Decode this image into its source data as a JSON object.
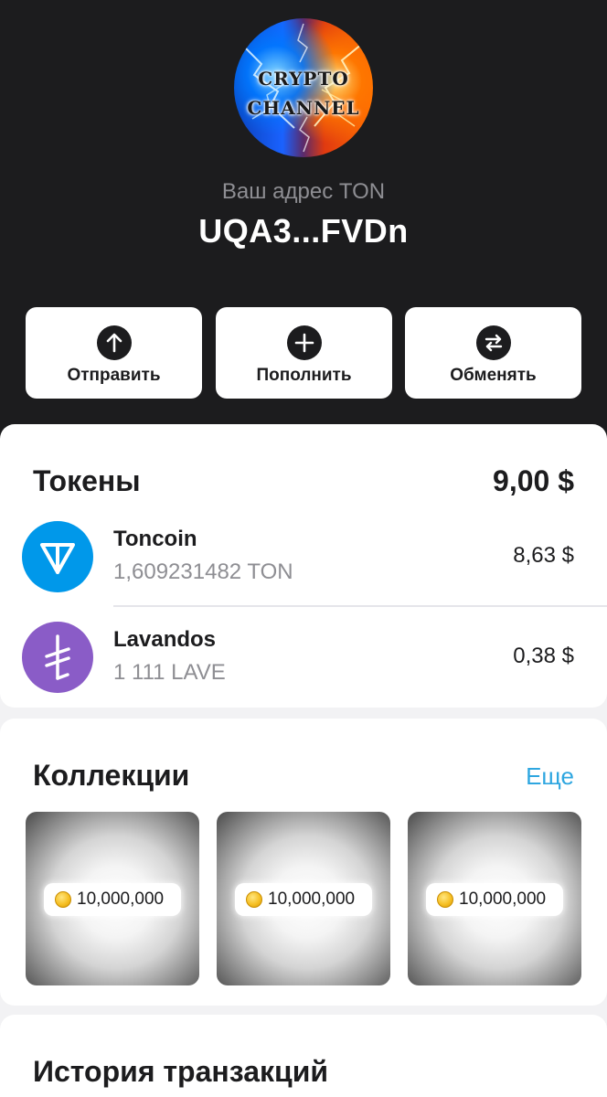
{
  "header": {
    "avatar_line1": "CRYPTO",
    "avatar_line2": "CHANNEL",
    "address_label": "Ваш адрес TON",
    "address": "UQA3...FVDn"
  },
  "actions": [
    {
      "label": "Отправить",
      "icon": "arrow-up-icon"
    },
    {
      "label": "Пополнить",
      "icon": "plus-icon"
    },
    {
      "label": "Обменять",
      "icon": "swap-icon"
    }
  ],
  "tokens": {
    "title": "Токены",
    "total": "9,00 $",
    "items": [
      {
        "name": "Toncoin",
        "amount": "1,609231482 TON",
        "usd": "8,63 $",
        "color": "#0098ea",
        "icon": "toncoin-logo-icon"
      },
      {
        "name": "Lavandos",
        "amount": "1 111 LAVE",
        "usd": "0,38 $",
        "color": "#8a5cc7",
        "icon": "lavandos-logo-icon"
      }
    ]
  },
  "collections": {
    "title": "Коллекции",
    "more": "Еще",
    "items": [
      {
        "price": "10,000,000",
        "icon": "coin-icon"
      },
      {
        "price": "10,000,000",
        "icon": "coin-icon"
      },
      {
        "price": "10,000,000",
        "icon": "coin-icon"
      }
    ]
  },
  "history": {
    "title": "История транзакций"
  },
  "colors": {
    "header_bg": "#1c1c1e",
    "page_bg": "#f2f2f4",
    "link": "#2ea6e0"
  }
}
